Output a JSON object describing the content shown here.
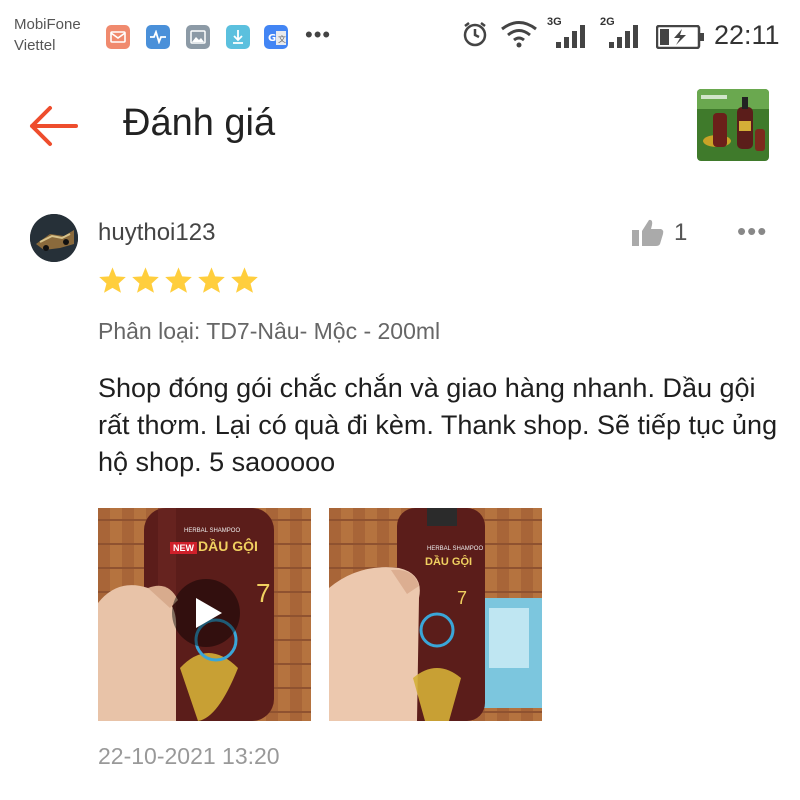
{
  "status_bar": {
    "carrier_1": "MobiFone",
    "carrier_2": "Viettel",
    "net_1": "3G",
    "net_2": "2G",
    "time": "22:11",
    "notification_icons": [
      "mail-icon",
      "health-icon",
      "gallery-icon",
      "download-icon",
      "google-translate-icon"
    ],
    "more_icon": "•••"
  },
  "header": {
    "back_icon": "back-arrow-icon",
    "title": "Đánh giá",
    "product_thumbnail": "product-thumbnail"
  },
  "review": {
    "username": "huythoi123",
    "like_count": "1",
    "rating": 5,
    "rating_max": 5,
    "variant": "Phân loại: TD7-Nâu- Mộc - 200ml",
    "text": "Shop đóng gói chắc chắn và giao hàng nhanh. Dầu gội rất thơm. Lại có quà đi kèm. Thank shop. Sẽ tiếp tục ủng hộ shop. 5 saooooo",
    "media": [
      {
        "type": "video",
        "bottle_label_1": "HERBAL SHAMPOO",
        "bottle_label_2": "NEW",
        "bottle_label_3": "DẦU GỘI",
        "bottle_label_4": "7"
      },
      {
        "type": "photo",
        "bottle_label_1": "HERBAL SHAMPOO",
        "bottle_label_2": "DẦU GỘI",
        "bottle_label_4": "7"
      }
    ],
    "date": "22-10-2021 13:20",
    "more_label": "•••"
  },
  "colors": {
    "accent": "#ee4d2d",
    "star": "#ffce3d",
    "bottle": "#5b1d1a",
    "background": "#ffffff"
  }
}
